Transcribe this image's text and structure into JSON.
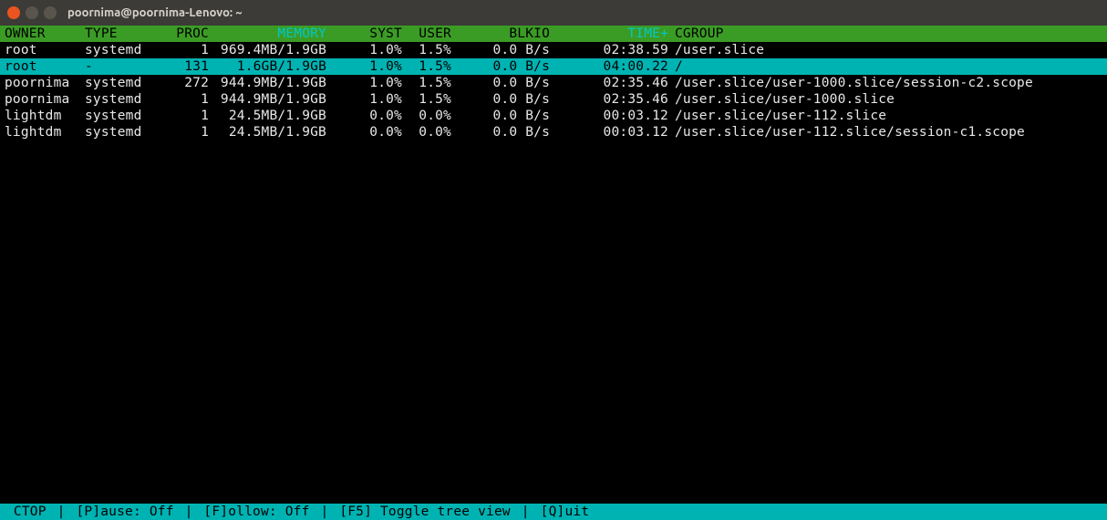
{
  "window": {
    "title": "poornima@poornima-Lenovo: ~"
  },
  "header": {
    "owner": "OWNER",
    "type": "TYPE",
    "proc": "PROC",
    "memory": "MEMORY",
    "syst": "SYST",
    "user": "USER",
    "blkio": "BLKIO",
    "time": "TIME+",
    "cgroup": "CGROUP"
  },
  "rows": [
    {
      "owner": "root",
      "type": "systemd",
      "proc": "1",
      "memory": "969.4MB/1.9GB",
      "syst": "1.0%",
      "user": "1.5%",
      "blkio": "0.0 B/s",
      "time": "02:38.59",
      "cgroup": "/user.slice",
      "selected": false
    },
    {
      "owner": "root",
      "type": "-",
      "proc": "131",
      "memory": "1.6GB/1.9GB",
      "syst": "1.0%",
      "user": "1.5%",
      "blkio": "0.0 B/s",
      "time": "04:00.22",
      "cgroup": "/",
      "selected": true
    },
    {
      "owner": "poornima",
      "type": "systemd",
      "proc": "272",
      "memory": "944.9MB/1.9GB",
      "syst": "1.0%",
      "user": "1.5%",
      "blkio": "0.0 B/s",
      "time": "02:35.46",
      "cgroup": "/user.slice/user-1000.slice/session-c2.scope",
      "selected": false
    },
    {
      "owner": "poornima",
      "type": "systemd",
      "proc": "1",
      "memory": "944.9MB/1.9GB",
      "syst": "1.0%",
      "user": "1.5%",
      "blkio": "0.0 B/s",
      "time": "02:35.46",
      "cgroup": "/user.slice/user-1000.slice",
      "selected": false
    },
    {
      "owner": "lightdm",
      "type": "systemd",
      "proc": "1",
      "memory": "24.5MB/1.9GB",
      "syst": "0.0%",
      "user": "0.0%",
      "blkio": "0.0 B/s",
      "time": "00:03.12",
      "cgroup": "/user.slice/user-112.slice",
      "selected": false
    },
    {
      "owner": "lightdm",
      "type": "systemd",
      "proc": "1",
      "memory": "24.5MB/1.9GB",
      "syst": "0.0%",
      "user": "0.0%",
      "blkio": "0.0 B/s",
      "time": "00:03.12",
      "cgroup": "/user.slice/user-112.slice/session-c1.scope",
      "selected": false
    }
  ],
  "status": {
    "app": " CTOP ",
    "pause": " [P]ause: Off ",
    "follow": " [F]ollow: Off ",
    "toggle": " [F5] Toggle tree view ",
    "quit": " [Q]uit"
  },
  "colors": {
    "header_bg": "#3b9c25",
    "highlight_bg": "#00b3b3",
    "titlebar_bg": "#3c3b37"
  }
}
